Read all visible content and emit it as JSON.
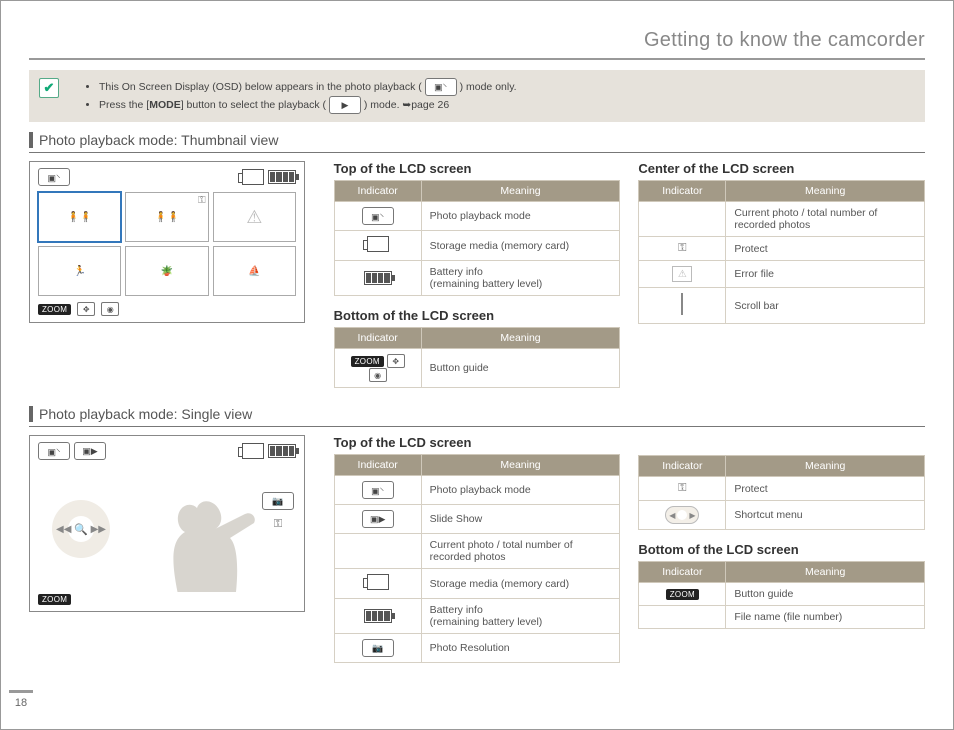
{
  "header": {
    "chapter_title": "Getting to know the camcorder"
  },
  "page_number": "18",
  "notes": {
    "bullet1_a": "This On Screen Display (OSD) below appears in the photo playback (",
    "bullet1_b": ") mode only.",
    "bullet2_a": "Press the [",
    "bullet2_mode": "MODE",
    "bullet2_b": "] button to select the playback (",
    "bullet2_c": ") mode. ",
    "bullet2_ref": "➥page 26"
  },
  "sections": {
    "thumb_title": "Photo playback mode: Thumbnail view",
    "single_title": "Photo playback mode: Single view"
  },
  "thumb_screen": {
    "zoom_label": "ZOOM"
  },
  "single_screen": {
    "zoom_label": "ZOOM"
  },
  "columns_thumb": {
    "mid": {
      "top_head": "Top of the LCD screen",
      "top_tbl": {
        "h1": "Indicator",
        "h2": "Meaning",
        "rows": [
          {
            "meaning": "Photo playback mode"
          },
          {
            "meaning": "Storage media (memory card)"
          },
          {
            "meaning": "Battery info\n(remaining battery level)"
          }
        ]
      },
      "bot_head": "Bottom of the LCD screen",
      "bot_tbl": {
        "h1": "Indicator",
        "h2": "Meaning",
        "rows": [
          {
            "meaning": "Button guide"
          }
        ]
      }
    },
    "right": {
      "center_head": "Center of the LCD screen",
      "tbl": {
        "h1": "Indicator",
        "h2": "Meaning",
        "rows": [
          {
            "meaning": "Current photo / total number of recorded photos"
          },
          {
            "meaning": "Protect"
          },
          {
            "meaning": "Error file"
          },
          {
            "meaning": "Scroll bar"
          }
        ]
      }
    }
  },
  "columns_single": {
    "mid": {
      "top_head": "Top of the LCD screen",
      "top_tbl": {
        "h1": "Indicator",
        "h2": "Meaning",
        "rows": [
          {
            "meaning": "Photo playback mode"
          },
          {
            "meaning": "Slide Show"
          },
          {
            "meaning": "Current photo / total number of recorded photos"
          },
          {
            "meaning": "Storage media (memory card)"
          },
          {
            "meaning": "Battery info\n(remaining battery level)"
          },
          {
            "meaning": "Photo Resolution"
          }
        ]
      }
    },
    "right": {
      "tbl_top": {
        "h1": "Indicator",
        "h2": "Meaning",
        "rows": [
          {
            "meaning": "Protect"
          },
          {
            "meaning": "Shortcut menu"
          }
        ]
      },
      "bot_head": "Bottom of the LCD screen",
      "tbl_bot": {
        "h1": "Indicator",
        "h2": "Meaning",
        "rows": [
          {
            "meaning": "Button guide"
          },
          {
            "meaning": "File name (file number)"
          }
        ]
      }
    }
  }
}
